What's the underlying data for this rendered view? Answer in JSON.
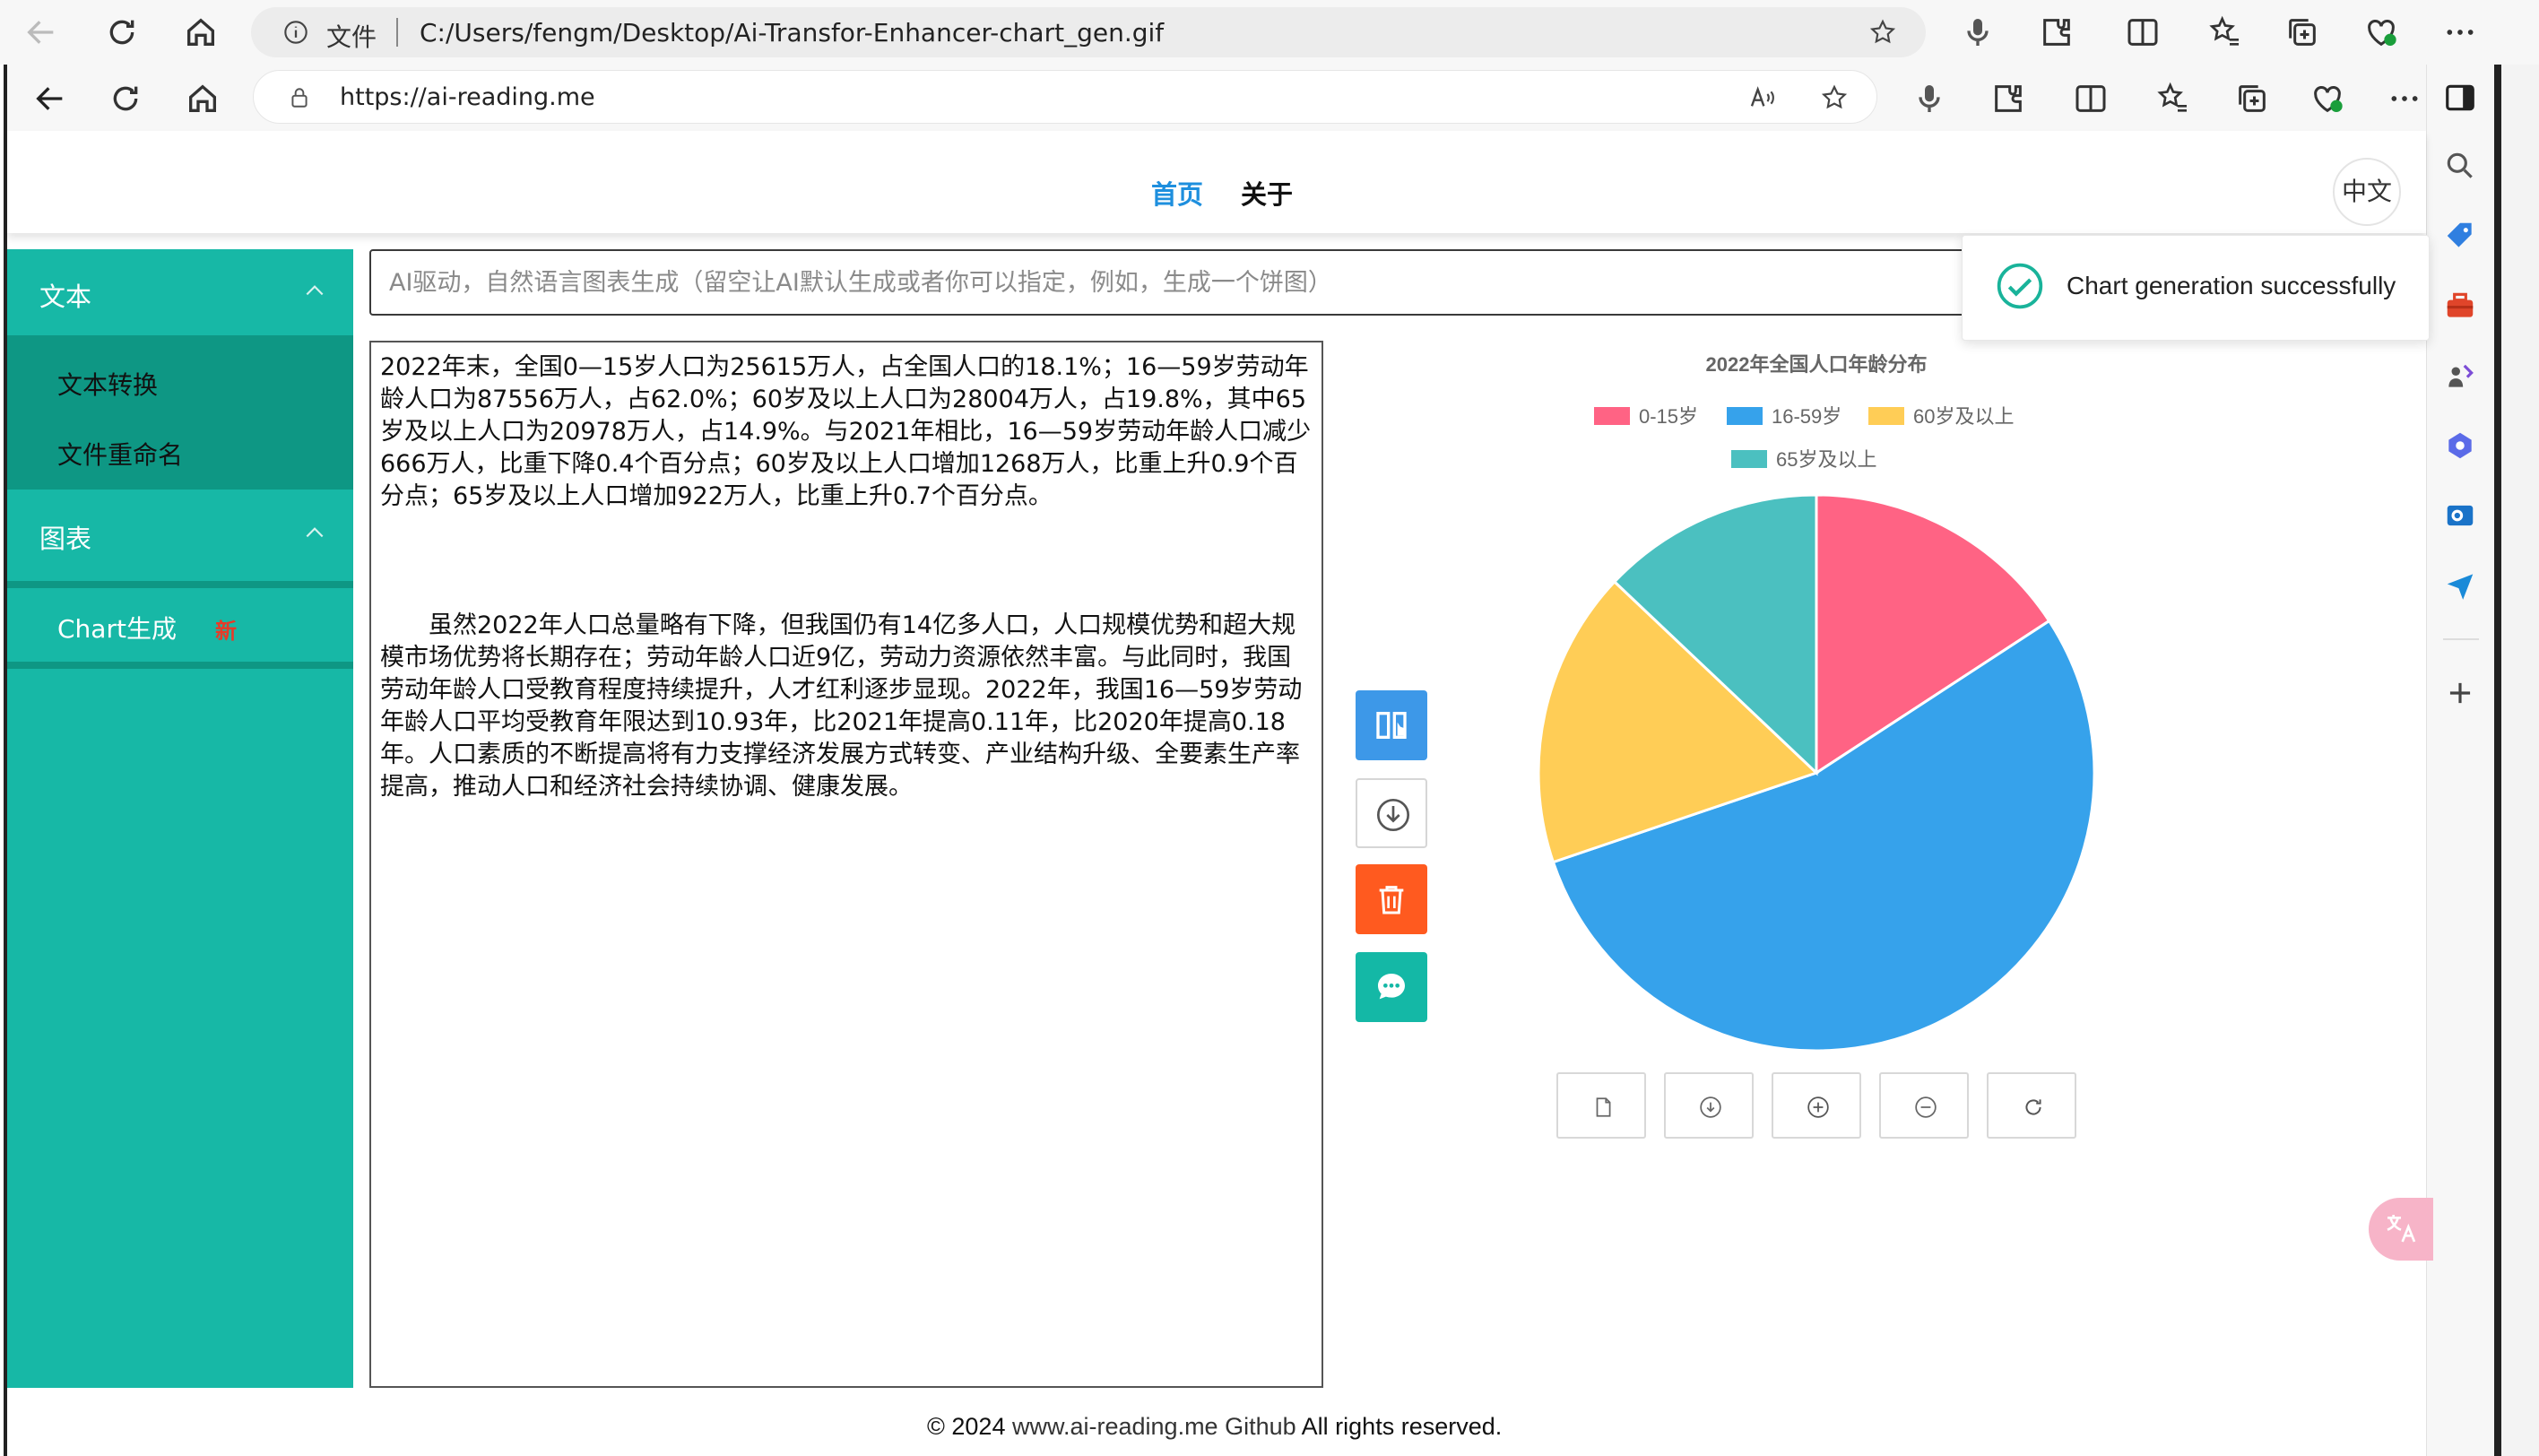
{
  "outer_browser": {
    "file_label": "文件",
    "path": "C:/Users/fengm/Desktop/Ai-Transfor-Enhancer-chart_gen.gif"
  },
  "inner_browser": {
    "url": "https://ai-reading.me"
  },
  "header": {
    "nav_home": "首页",
    "nav_about": "关于",
    "lang": "中文"
  },
  "sidebar": {
    "groups": [
      {
        "title": "文本",
        "items": [
          "文本转换",
          "文件重命名"
        ]
      },
      {
        "title": "图表",
        "items": [
          "Chart生成"
        ],
        "new_badge": "新"
      }
    ]
  },
  "prompt": {
    "placeholder": "AI驱动，自然语言图表生成（留空让AI默认生成或者你可以指定，例如，生成一个饼图）"
  },
  "editor": {
    "paragraph1": "2022年末，全国0—15岁人口为25615万人，占全国人口的18.1%；16—59岁劳动年龄人口为87556万人，占62.0%；60岁及以上人口为28004万人，占19.8%，其中65岁及以上人口为20978万人，占14.9%。与2021年相比，16—59岁劳动年龄人口减少666万人，比重下降0.4个百分点；60岁及以上人口增加1268万人，比重上升0.9个百分点；65岁及以上人口增加922万人，比重上升0.7个百分点。",
    "paragraph2": "虽然2022年人口总量略有下降，但我国仍有14亿多人口，人口规模优势和超大规模市场优势将长期存在；劳动年龄人口近9亿，劳动力资源依然丰富。与此同时，我国劳动年龄人口受教育程度持续提升，人才红利逐步显现。2022年，我国16—59岁劳动年龄人口平均受教育年限达到10.93年，比2021年提高0.11年，比2020年提高0.18年。人口素质的不断提高将有力支撑经济发展方式转变、产业结构升级、全要素生产率提高，推动人口和经济社会持续协调、健康发展。"
  },
  "toast": {
    "message": "Chart generation successfully"
  },
  "chart_data": {
    "type": "pie",
    "title": "2022年全国人口年龄分布",
    "categories": [
      "0-15岁",
      "16-59岁",
      "60岁及以上",
      "65岁及以上"
    ],
    "values": [
      25615,
      87556,
      28004,
      20978
    ],
    "colors": [
      "#ff6384",
      "#36a2eb",
      "#ffcd56",
      "#4bc0c0"
    ],
    "legend_position": "top"
  },
  "footer": {
    "copyright": "© 2024",
    "site": "www.ai-reading.me",
    "github": "Github",
    "rights": "All rights reserved."
  },
  "colors": {
    "sidebar": "#17b8a6",
    "sidebar_sub": "#0e9784",
    "nav_active": "#1e8fde",
    "btn_switch": "#3d98e8",
    "btn_delete": "#ff5a1f",
    "btn_chat": "#14b8a6"
  }
}
